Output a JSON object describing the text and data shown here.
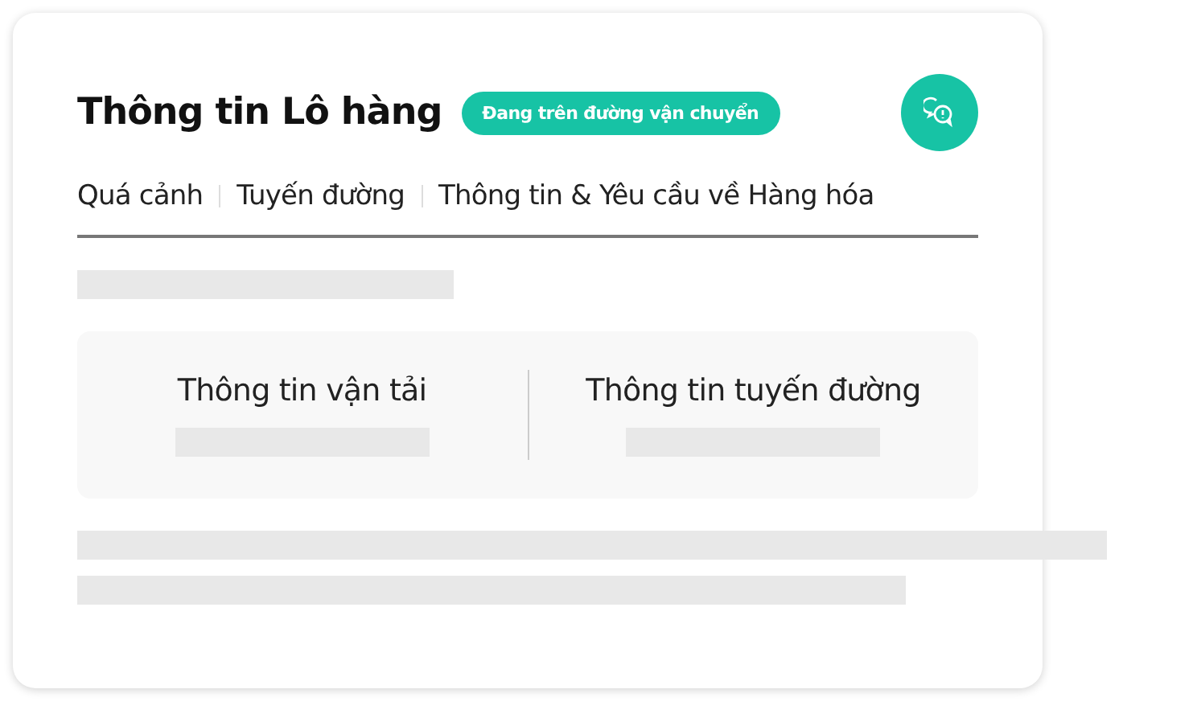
{
  "card": {
    "title": "Thông tin Lô hàng",
    "status_badge": "Đang trên đường vận chuyển"
  },
  "tabs": [
    {
      "label": "Quá cảnh",
      "selected": false
    },
    {
      "label": "Tuyến đường",
      "selected": false
    },
    {
      "label": "Thông tin & Yêu cầu về Hàng hóa",
      "selected": false
    }
  ],
  "summary": {
    "columns": [
      {
        "heading": "Thông tin vận tải"
      },
      {
        "heading": "Thông tin tuyến đường"
      }
    ]
  }
}
